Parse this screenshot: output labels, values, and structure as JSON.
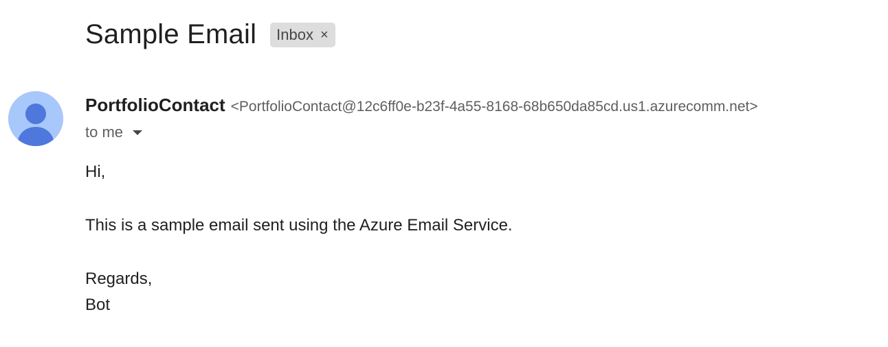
{
  "email": {
    "subject": "Sample Email",
    "label": "Inbox",
    "label_remove": "×",
    "sender": {
      "name": "PortfolioContact",
      "address": "<PortfolioContact@12c6ff0e-b23f-4a55-8168-68b650da85cd.us1.azurecomm.net>"
    },
    "recipient": "to me",
    "body": {
      "greeting": "Hi,",
      "message": "This is a sample email sent using the Azure Email Service.",
      "closing": "Regards,",
      "signature": "Bot"
    }
  },
  "colors": {
    "avatar_background": "#a8c7fa",
    "avatar_figure": "#4f78dd",
    "chip_background": "#dddddd"
  },
  "icons": {
    "avatar": "person-avatar-icon",
    "label_remove": "close-icon",
    "details": "caret-down-icon"
  }
}
